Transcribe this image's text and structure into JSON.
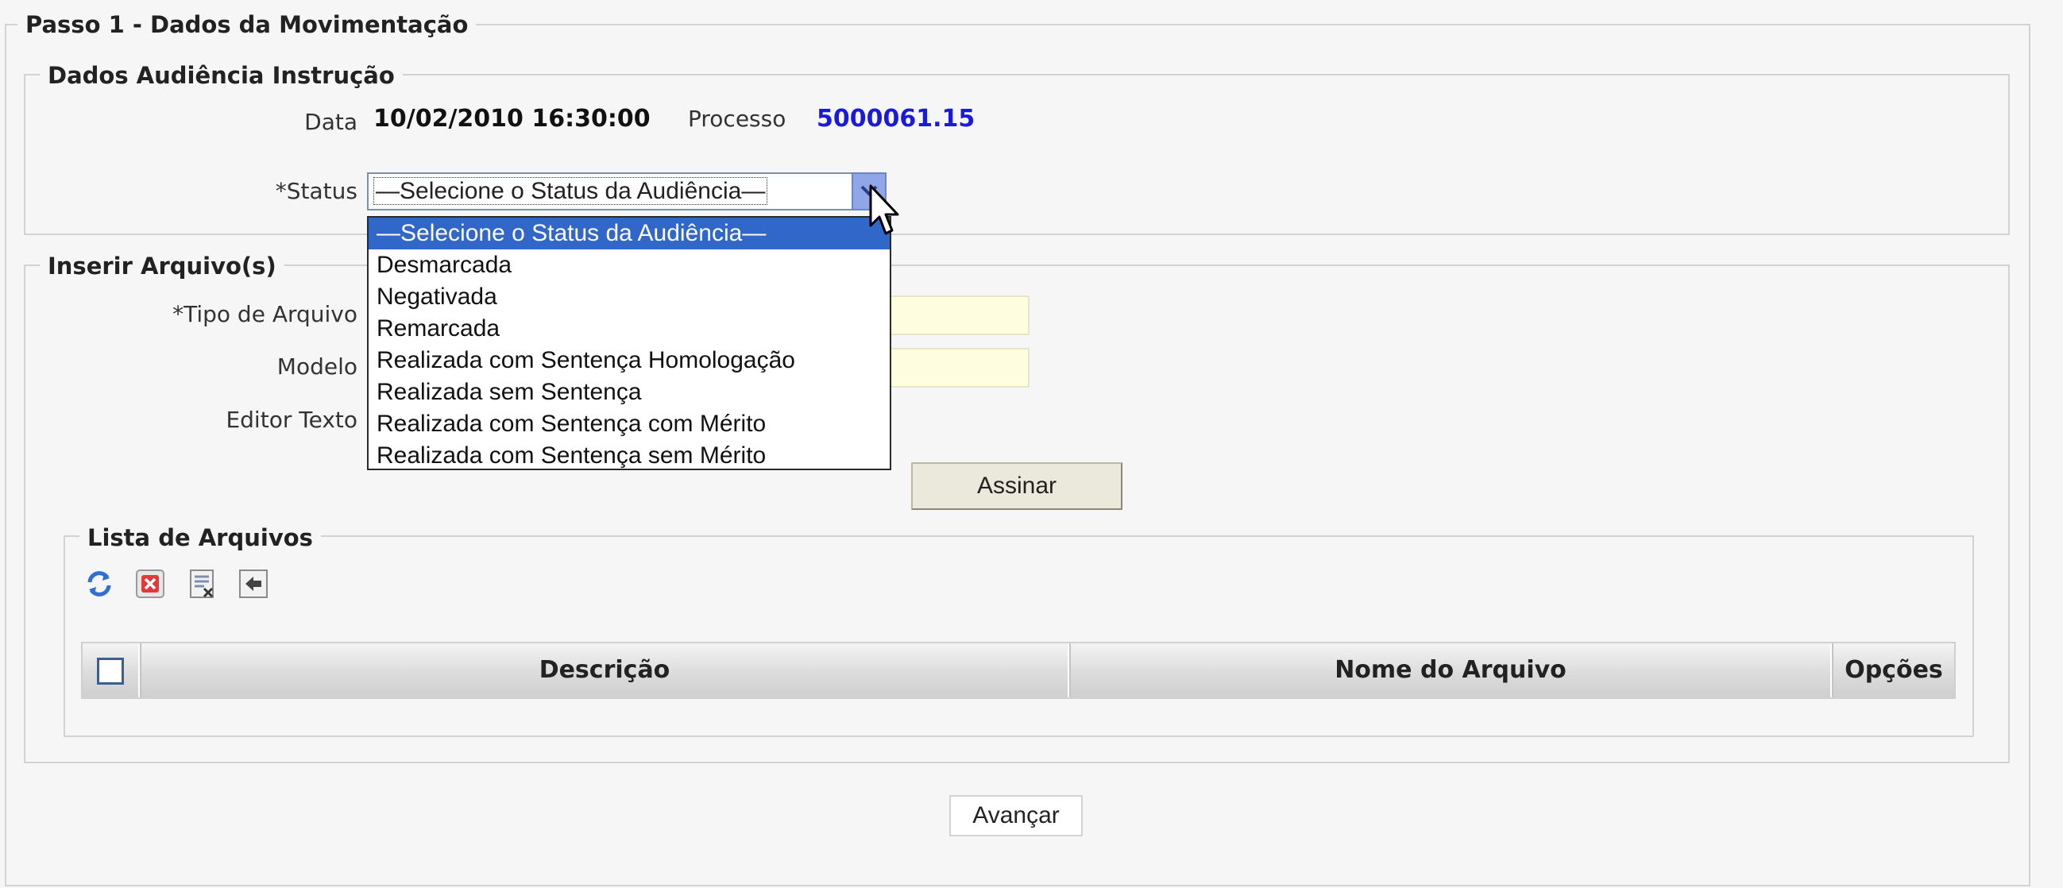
{
  "step": {
    "legend": "Passo 1 - Dados da Movimentação"
  },
  "audiencia": {
    "legend": "Dados Audiência Instrução",
    "data_label": "Data",
    "data_value": "10/02/2010 16:30:00",
    "processo_label": "Processo",
    "processo_value": "5000061.15",
    "status_label": "*Status",
    "status_selected": "—Selecione o Status da Audiência—",
    "status_options": [
      "—Selecione o Status da Audiência—",
      "Desmarcada",
      "Negativada",
      "Remarcada",
      "Realizada com Sentença Homologação",
      "Realizada sem Sentença",
      "Realizada com Sentença com Mérito",
      "Realizada com Sentença sem Mérito"
    ]
  },
  "arquivos": {
    "legend": "Inserir Arquivo(s)",
    "tipo_label": "*Tipo de Arquivo",
    "modelo_label": "Modelo",
    "editor_label": "Editor Texto",
    "assinar_label": "Assinar"
  },
  "lista": {
    "legend": "Lista de Arquivos",
    "toolbar_icons": [
      "refresh-icon",
      "delete-icon",
      "remove-selected-icon",
      "import-icon"
    ],
    "columns": [
      "Descrição",
      "Nome do Arquivo",
      "Opções"
    ]
  },
  "footer": {
    "avancar_label": "Avançar"
  },
  "colors": {
    "background": "#f6f6f6",
    "process_link": "#1a1adc",
    "selected_option": "#3167c9",
    "required_field": "#fffde0"
  }
}
